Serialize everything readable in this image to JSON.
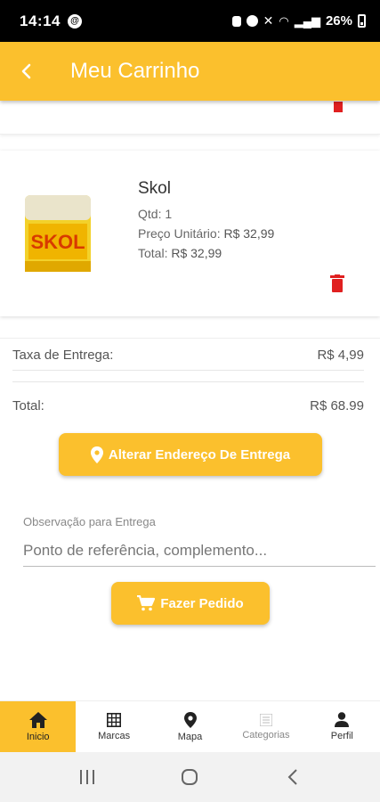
{
  "status_bar": {
    "time": "14:14",
    "battery_percent": "26%"
  },
  "app_bar": {
    "title": "Meu Carrinho",
    "back_icon": "arrow-back-icon"
  },
  "cart": {
    "items": [
      {
        "name": "Skol",
        "quantity_label": "Qtd: 1",
        "unit_price_label": "Preço Unitário:",
        "unit_price": "R$ 32,99",
        "total_label": "Total:",
        "total": "R$ 32,99",
        "image_text": "SKOL"
      }
    ]
  },
  "summary": {
    "delivery_fee_label": "Taxa de Entrega:",
    "delivery_fee": "R$ 4,99",
    "total_label": "Total:",
    "total": "R$ 68.99"
  },
  "actions": {
    "change_address": "Alterar Endereço De Entrega",
    "place_order": "Fazer Pedido"
  },
  "observation": {
    "label": "Observação para Entrega",
    "placeholder": "Ponto de referência, complemento..."
  },
  "bottom_nav": [
    {
      "label": "Inicio",
      "icon": "home-icon",
      "active": true
    },
    {
      "label": "Marcas",
      "icon": "grid-icon",
      "active": false
    },
    {
      "label": "Mapa",
      "icon": "map-pin-icon",
      "active": false
    },
    {
      "label": "Categorias",
      "icon": "categories-icon",
      "active": false
    },
    {
      "label": "Perfil",
      "icon": "person-icon",
      "active": false
    }
  ],
  "colors": {
    "primary": "#fbc02d",
    "delete": "#e02020"
  }
}
